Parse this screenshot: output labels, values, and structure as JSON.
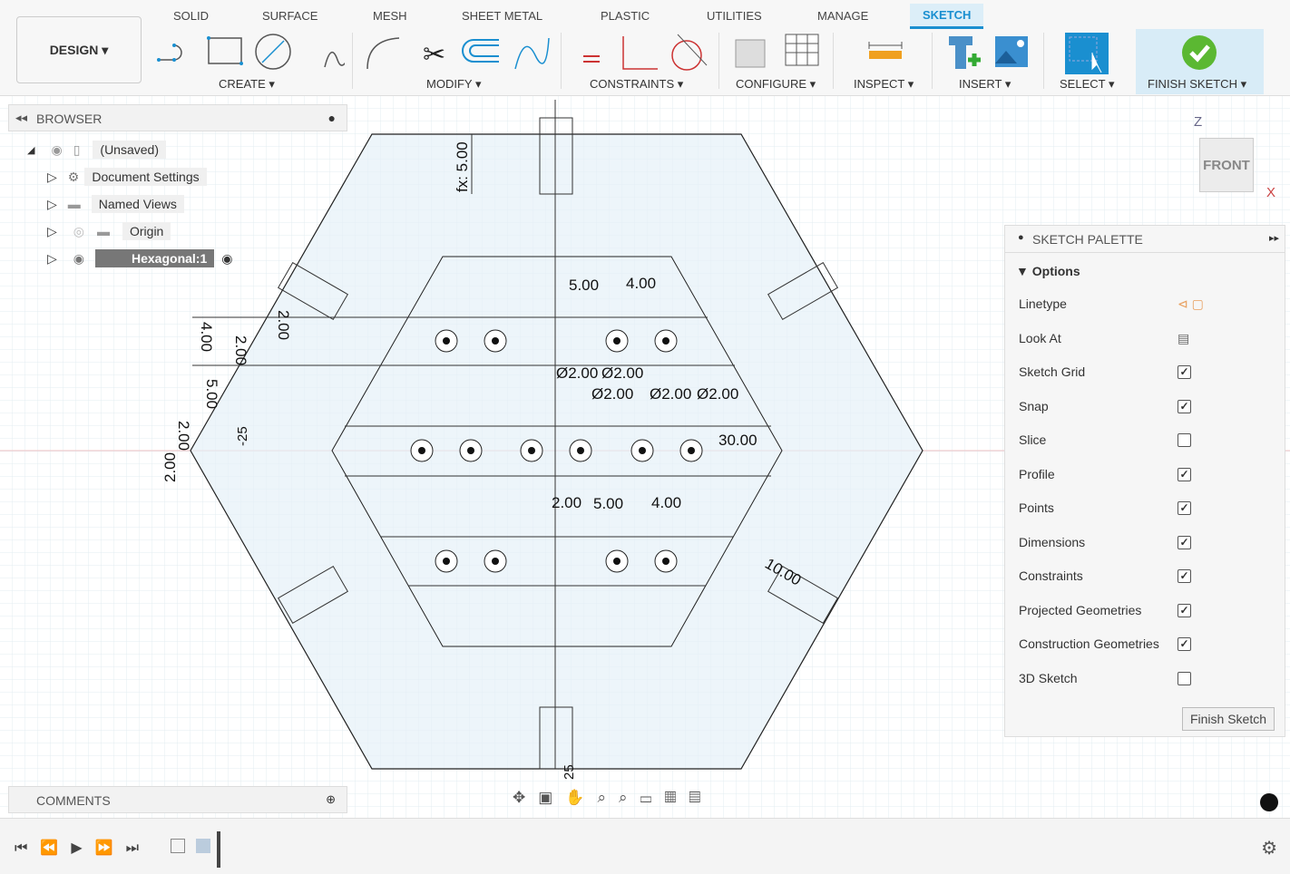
{
  "toolbar": {
    "workspace": "DESIGN",
    "tabs": [
      "SOLID",
      "SURFACE",
      "MESH",
      "SHEET METAL",
      "PLASTIC",
      "UTILITIES",
      "MANAGE",
      "SKETCH"
    ],
    "active_tab": "SKETCH",
    "groups": [
      "CREATE",
      "MODIFY",
      "CONSTRAINTS",
      "CONFIGURE",
      "INSPECT",
      "INSERT",
      "SELECT",
      "FINISH SKETCH"
    ]
  },
  "browser": {
    "title": "BROWSER",
    "items": [
      {
        "label": "(Unsaved)"
      },
      {
        "label": "Document Settings"
      },
      {
        "label": "Named Views"
      },
      {
        "label": "Origin"
      },
      {
        "label": "Hexagonal:1"
      }
    ]
  },
  "comments": {
    "title": "COMMENTS"
  },
  "viewcube": {
    "face": "FRONT",
    "axis_z": "Z",
    "axis_x": "X"
  },
  "sketch_palette": {
    "title": "SKETCH PALETTE",
    "section": "Options",
    "options": [
      {
        "label": "Linetype",
        "type": "icons"
      },
      {
        "label": "Look At",
        "type": "button"
      },
      {
        "label": "Sketch Grid",
        "checked": true
      },
      {
        "label": "Snap",
        "checked": true
      },
      {
        "label": "Slice",
        "checked": false
      },
      {
        "label": "Profile",
        "checked": true
      },
      {
        "label": "Points",
        "checked": true
      },
      {
        "label": "Dimensions",
        "checked": true
      },
      {
        "label": "Constraints",
        "checked": true
      },
      {
        "label": "Projected Geometries",
        "checked": true
      },
      {
        "label": "Construction Geometries",
        "checked": true
      },
      {
        "label": "3D Sketch",
        "checked": false
      }
    ],
    "finish_button": "Finish Sketch"
  },
  "dimensions": [
    "fx: 5.00",
    "5.00",
    "4.00",
    "2.00",
    "2.00",
    "4.00",
    "5.00",
    "2.00",
    "2.00",
    "-25",
    "Ø2.00",
    "Ø2.00",
    "Ø2.00",
    "Ø2.00",
    "Ø2.00",
    "30.00",
    "2.00",
    "5.00",
    "4.00",
    "10.00",
    "25"
  ],
  "colors": {
    "accent": "#1a8fd0",
    "finish_green": "#5bb832",
    "sketch_fill": "#e6f1f8",
    "grid": "#dde8ef"
  }
}
